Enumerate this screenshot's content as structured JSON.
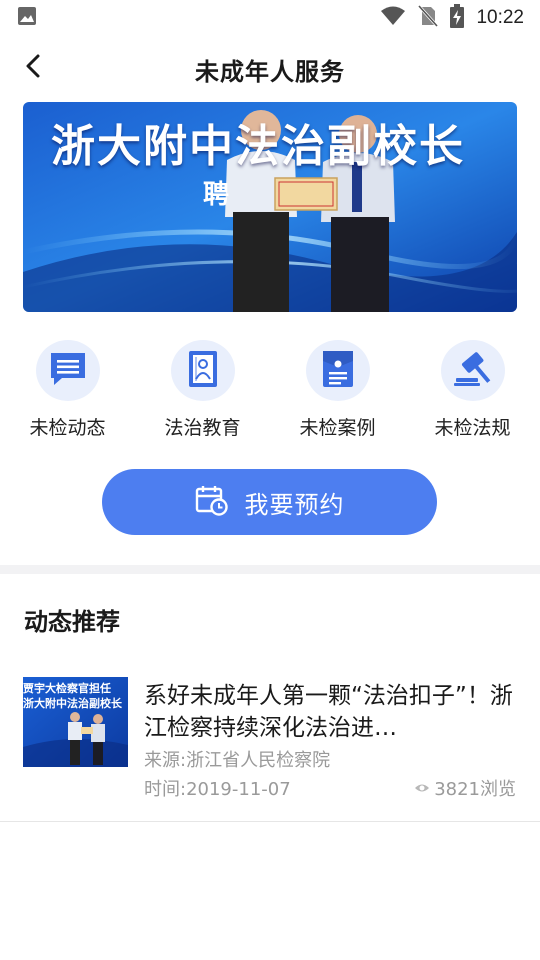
{
  "status_bar": {
    "time": "10:22",
    "icons": [
      "image-icon",
      "wifi-icon",
      "no-sim-icon",
      "battery-charging-icon"
    ]
  },
  "header": {
    "title": "未成年人服务",
    "back_icon": "chevron-left-icon"
  },
  "banner": {
    "caption": "浙大附中法治副校长",
    "sub_caption": "聘"
  },
  "quick_menu": [
    {
      "label": "未检动态",
      "icon": "chat-message-icon"
    },
    {
      "label": "法治教育",
      "icon": "law-book-icon"
    },
    {
      "label": "未检案例",
      "icon": "case-folder-icon"
    },
    {
      "label": "未检法规",
      "icon": "gavel-icon"
    }
  ],
  "appointment": {
    "label": "我要预约",
    "icon": "calendar-clock-icon"
  },
  "recommend": {
    "section_title": "动态推荐",
    "items": [
      {
        "title": "系好未成年人第一颗“法治扣子”！浙江检察持续深化法治进…",
        "thumb_caption_1": "贾宇大检察官担任",
        "thumb_caption_2": "浙大附中法治副校长",
        "source_label": "来源:",
        "source": "浙江省人民检察院",
        "time_label": "时间:",
        "time": "2019-11-07",
        "views": "3821浏览"
      }
    ]
  },
  "colors": {
    "accent": "#4d7ef0",
    "icon_bg": "#e9effc",
    "icon_blue": "#3a6de0",
    "muted_text": "#9a9a9a"
  }
}
